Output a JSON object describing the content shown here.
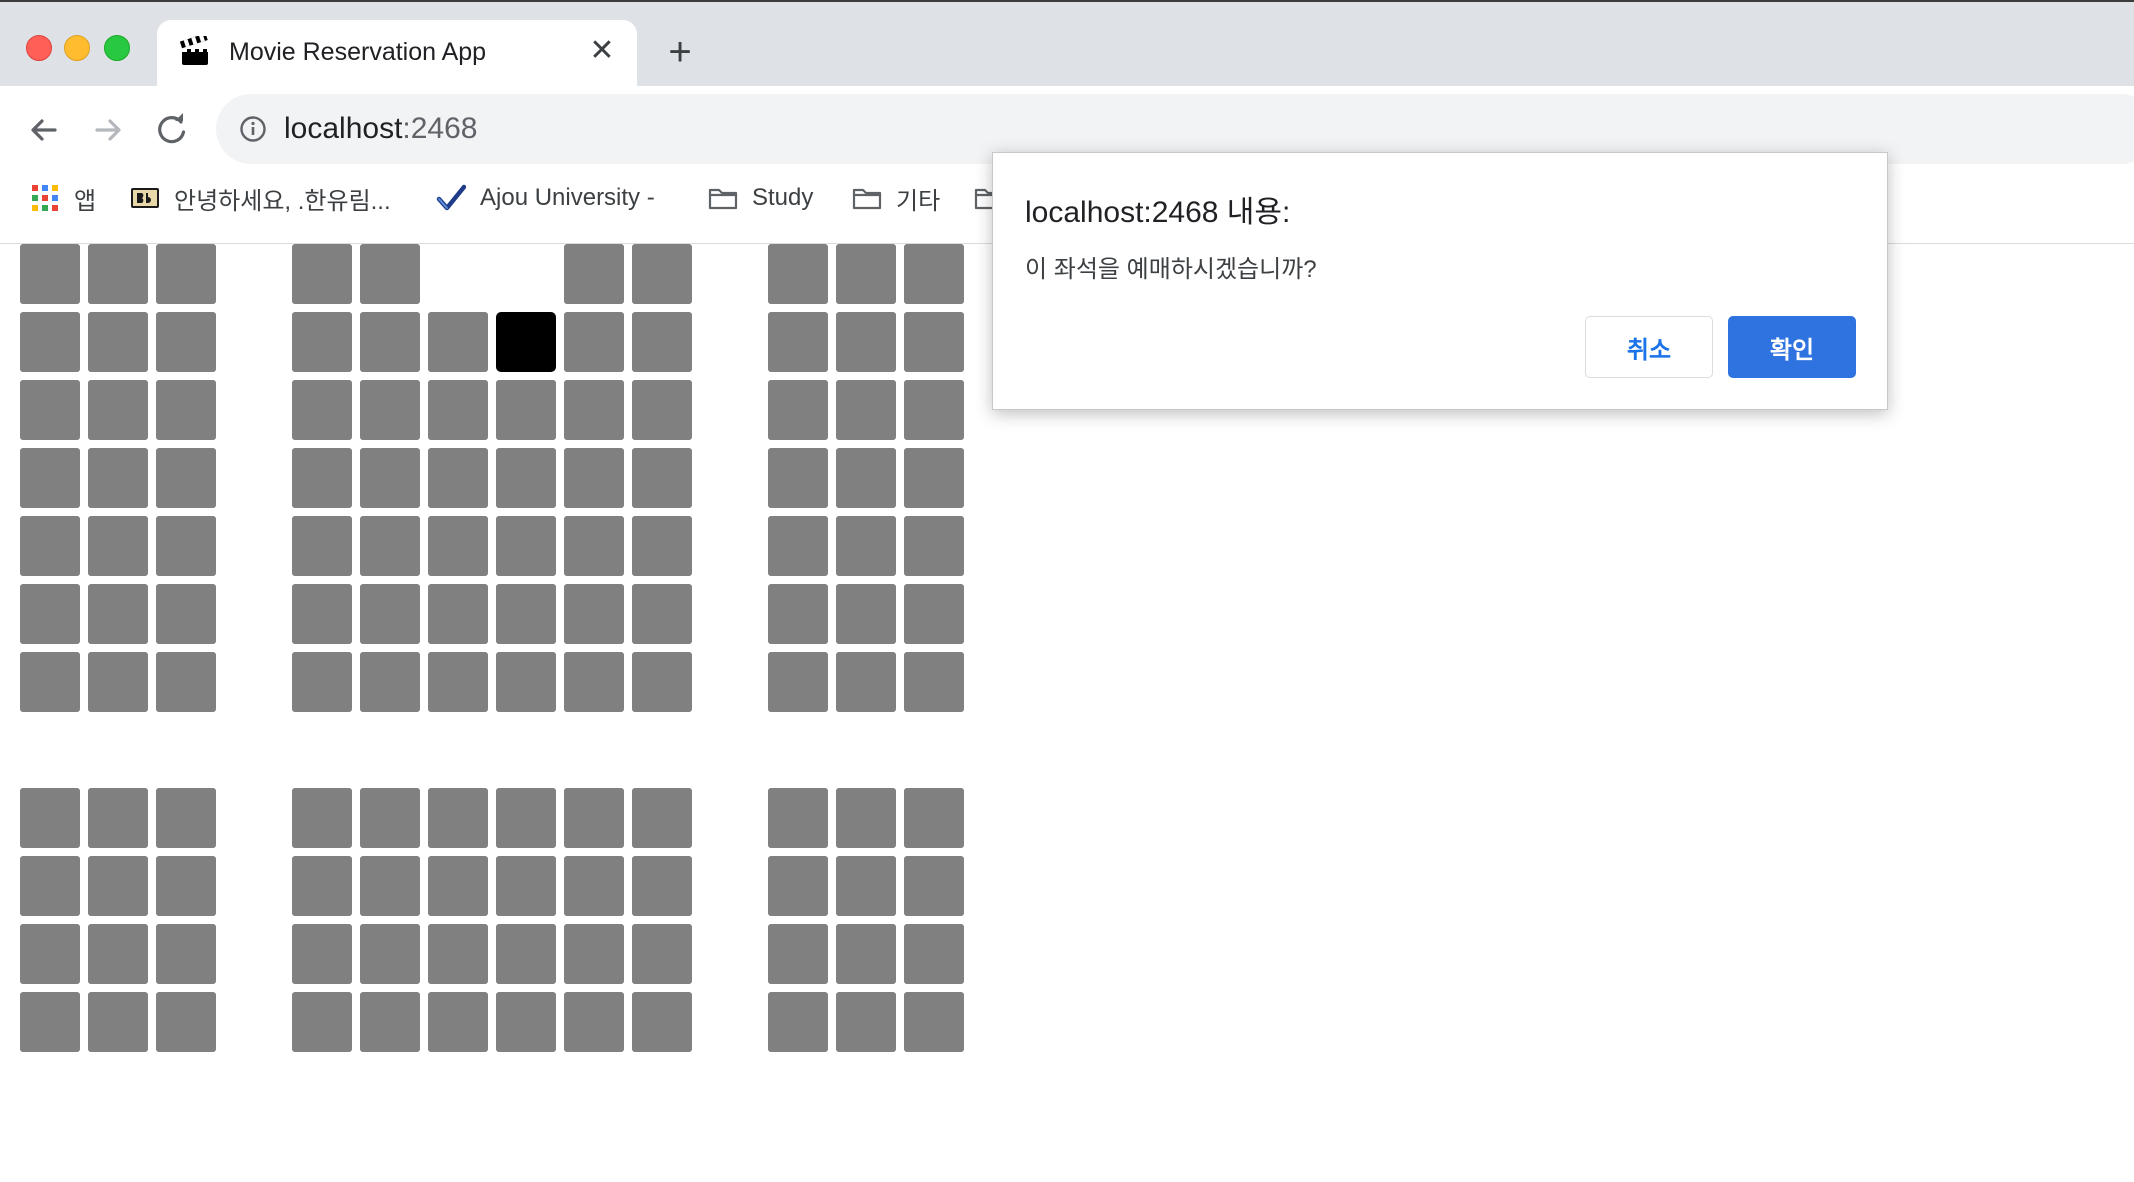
{
  "browser": {
    "tab_title": "Movie Reservation App",
    "tab_close": "✕",
    "new_tab": "+",
    "url_host": "localhost",
    "url_port": ":2468",
    "bookmarks": [
      {
        "label": "앱",
        "icon": "apps-grid-icon"
      },
      {
        "label": "안녕하세요, .한유림...",
        "icon": "blackboard-icon"
      },
      {
        "label": "Ajou University -",
        "icon": "checkmark-icon"
      },
      {
        "label": "Study",
        "icon": "folder-icon"
      },
      {
        "label": "기타",
        "icon": "folder-icon"
      }
    ]
  },
  "dialog": {
    "title": "localhost:2468 내용:",
    "message": "이 좌석을 예매하시겠습니까?",
    "cancel_label": "취소",
    "ok_label": "확인"
  },
  "seat_map": {
    "seat_color": "#808080",
    "selected_color": "#000000",
    "blocks": [
      {
        "section": "top-left",
        "rows": 7,
        "cols": 3,
        "missing": [],
        "selected": []
      },
      {
        "section": "top-center",
        "rows": 7,
        "cols": 6,
        "missing": [
          [
            0,
            2
          ],
          [
            0,
            3
          ]
        ],
        "selected": [
          [
            1,
            3
          ]
        ]
      },
      {
        "section": "top-right",
        "rows": 7,
        "cols": 3,
        "missing": [],
        "selected": []
      },
      {
        "section": "bottom-left",
        "rows": 4,
        "cols": 3,
        "missing": [],
        "selected": []
      },
      {
        "section": "bottom-center",
        "rows": 4,
        "cols": 6,
        "missing": [],
        "selected": []
      },
      {
        "section": "bottom-right",
        "rows": 4,
        "cols": 3,
        "missing": [],
        "selected": []
      }
    ]
  }
}
